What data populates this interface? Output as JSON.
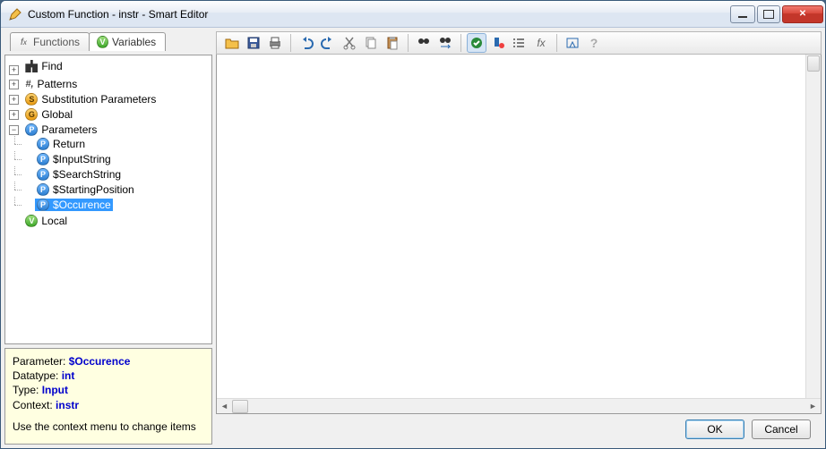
{
  "window": {
    "title": "Custom Function - instr - Smart Editor"
  },
  "tabs": {
    "functions": {
      "label": "Functions"
    },
    "variables": {
      "label": "Variables"
    }
  },
  "tree": {
    "find": "Find",
    "patterns": "Patterns",
    "substitution": "Substitution Parameters",
    "global": "Global",
    "parameters": "Parameters",
    "local": "Local",
    "params": {
      "return": "Return",
      "input_string": "$InputString",
      "search_string": "$SearchString",
      "starting_position": "$StartingPosition",
      "occurence": "$Occurence"
    }
  },
  "info": {
    "parameter_label": "Parameter: ",
    "parameter_value": "$Occurence",
    "datatype_label": "Datatype: ",
    "datatype_value": "int",
    "type_label": "Type: ",
    "type_value": "Input",
    "context_label": "Context: ",
    "context_value": "instr",
    "hint": "Use the context menu to change items"
  },
  "buttons": {
    "ok": "OK",
    "cancel": "Cancel"
  },
  "toolbar_icons": [
    "open-icon",
    "save-icon",
    "print-icon",
    "sep",
    "undo-icon",
    "redo-icon",
    "cut-icon",
    "copy-icon",
    "paste-icon",
    "sep",
    "find-icon",
    "find-replace-icon",
    "sep",
    "validate-icon",
    "bookmark-icon",
    "list-icon",
    "fx-icon",
    "sep",
    "highlight-icon",
    "help-icon"
  ]
}
